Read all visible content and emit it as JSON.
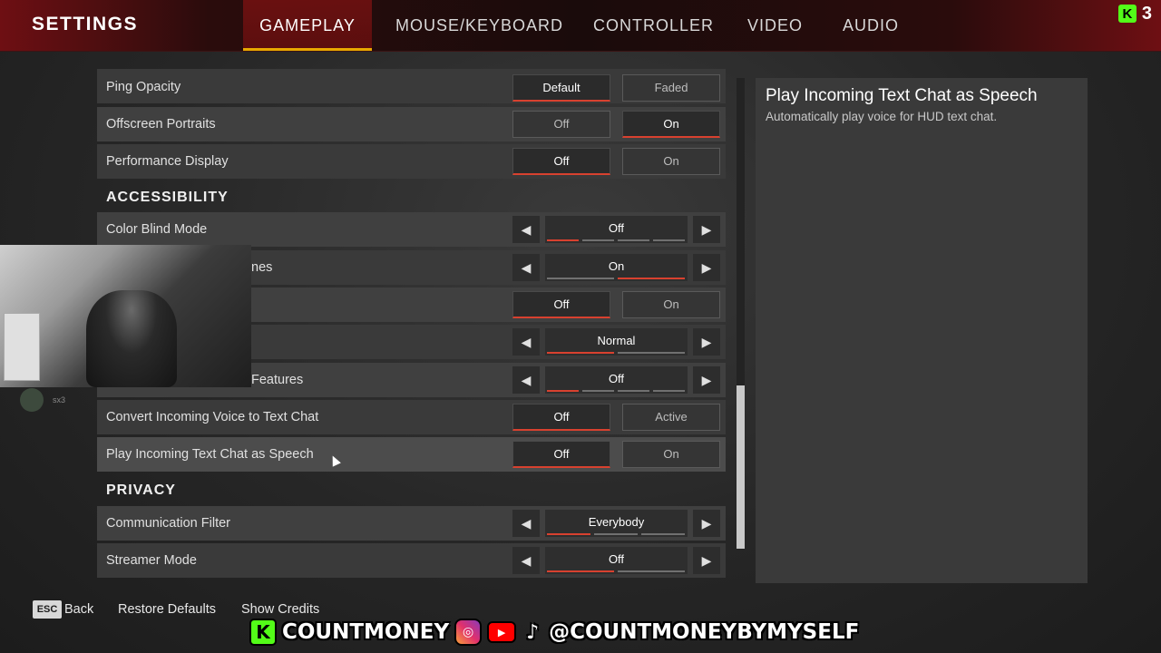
{
  "header": {
    "title": "SETTINGS",
    "tabs": [
      {
        "label": "GAMEPLAY",
        "active": true
      },
      {
        "label": "MOUSE/KEYBOARD",
        "active": false
      },
      {
        "label": "CONTROLLER",
        "active": false
      },
      {
        "label": "VIDEO",
        "active": false
      },
      {
        "label": "AUDIO",
        "active": false
      }
    ],
    "viewer_count": "3",
    "viewer_icon": "kick-logo-icon",
    "kick_glyph": "K"
  },
  "settings": {
    "ping_opacity": {
      "label": "Ping Opacity",
      "options": [
        "Default",
        "Faded"
      ],
      "selected": "Default"
    },
    "offscreen_portraits": {
      "label": "Offscreen Portraits",
      "options": [
        "Off",
        "On"
      ],
      "selected": "On"
    },
    "performance_display": {
      "label": "Performance Display",
      "options": [
        "Off",
        "On"
      ],
      "selected": "Off"
    },
    "accessibility_header": "ACCESSIBILITY",
    "color_blind_mode": {
      "label": "Color Blind Mode",
      "value": "Off",
      "index": 0,
      "count": 4
    },
    "row_hidden_1": {
      "label": "nes",
      "value": "On",
      "index": 1,
      "count": 2
    },
    "row_hidden_2": {
      "options": [
        "Off",
        "On"
      ],
      "selected": "Off"
    },
    "row_hidden_3": {
      "value": "Normal",
      "index": 0,
      "count": 2
    },
    "row_hidden_4": {
      "label": "Features",
      "value": "Off",
      "index": 0,
      "count": 4
    },
    "convert_voice": {
      "label": "Convert Incoming Voice to Text Chat",
      "options": [
        "Off",
        "Active"
      ],
      "selected": "Off"
    },
    "play_text_speech": {
      "label": "Play Incoming Text Chat as Speech",
      "options": [
        "Off",
        "On"
      ],
      "selected": "Off"
    },
    "privacy_header": "PRIVACY",
    "communication_filter": {
      "label": "Communication Filter",
      "value": "Everybody",
      "index": 0,
      "count": 3
    },
    "streamer_mode": {
      "label": "Streamer Mode",
      "value": "Off",
      "index": 0,
      "count": 2
    }
  },
  "description": {
    "title": "Play Incoming Text Chat as Speech",
    "text": "Automatically play voice for HUD text chat."
  },
  "footer": {
    "esc_key": "ESC",
    "back": "Back",
    "restore_defaults": "Restore Defaults",
    "show_credits": "Show Credits"
  },
  "overlay": {
    "kick_glyph": "K",
    "name": "COUNTMONEY",
    "handle": "@COUNTMONEYBYMYSELF",
    "ghost_name": "sx3",
    "icons": [
      "kick-logo-icon",
      "instagram-icon",
      "youtube-icon",
      "tiktok-icon"
    ]
  },
  "colors": {
    "accent_red": "#d8412f",
    "tab_underline": "#e8a800",
    "kick_green": "#53fc18"
  }
}
